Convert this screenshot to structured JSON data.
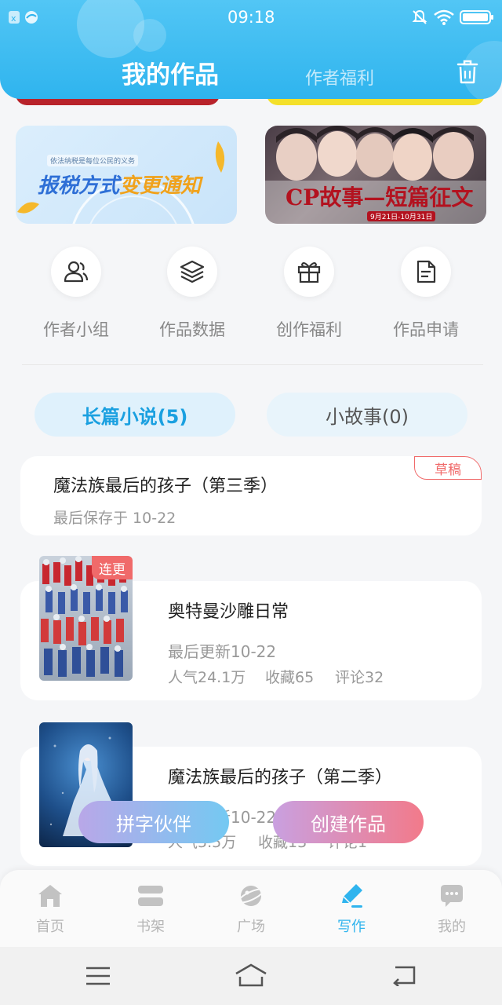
{
  "status_bar": {
    "time": "09:18"
  },
  "header": {
    "title": "我的作品",
    "tab_benefits": "作者福利"
  },
  "banners": [
    {
      "small_text": "依法纳税是每位公民的义务",
      "main_text_1": "报税方式",
      "main_text_2": "变更通知"
    },
    {
      "main_text": "CP故事—短篇征文",
      "date_text": "9月21日-10月31日"
    }
  ],
  "quick_actions": [
    {
      "label": "作者小组",
      "icon": "group-icon"
    },
    {
      "label": "作品数据",
      "icon": "layers-icon"
    },
    {
      "label": "创作福利",
      "icon": "gift-icon"
    },
    {
      "label": "作品申请",
      "icon": "document-icon"
    }
  ],
  "category_tabs": [
    {
      "label": "长篇小说(5)",
      "active": true
    },
    {
      "label": "小故事(0)",
      "active": false
    }
  ],
  "draft": {
    "title": "魔法族最后的孩子（第三季）",
    "saved": "最后保存于 10-22",
    "badge": "草稿"
  },
  "works": [
    {
      "title": "奥特曼沙雕日常",
      "updated": "最后更新10-22",
      "popularity": "人气24.1万",
      "favorites": "收藏65",
      "comments": "评论32",
      "badge": "连更"
    },
    {
      "title": "魔法族最后的孩子（第二季）",
      "updated": "最后更新10-22",
      "popularity": "人气5.5万",
      "favorites": "收藏13",
      "comments": "评论1"
    }
  ],
  "fab": {
    "partner": "拼字伙伴",
    "create": "创建作品"
  },
  "bottom_nav": [
    {
      "label": "首页",
      "icon": "home-icon",
      "active": false
    },
    {
      "label": "书架",
      "icon": "bookshelf-icon",
      "active": false
    },
    {
      "label": "广场",
      "icon": "planet-icon",
      "active": false
    },
    {
      "label": "写作",
      "icon": "pen-icon",
      "active": true
    },
    {
      "label": "我的",
      "icon": "chat-icon",
      "active": false
    }
  ],
  "colors": {
    "primary": "#2fb4ee",
    "active_tab_text": "#1aa0e0",
    "badge_red": "#f06a6a",
    "fab_left": "#8ec5f5",
    "fab_right": "#f27a8a"
  }
}
